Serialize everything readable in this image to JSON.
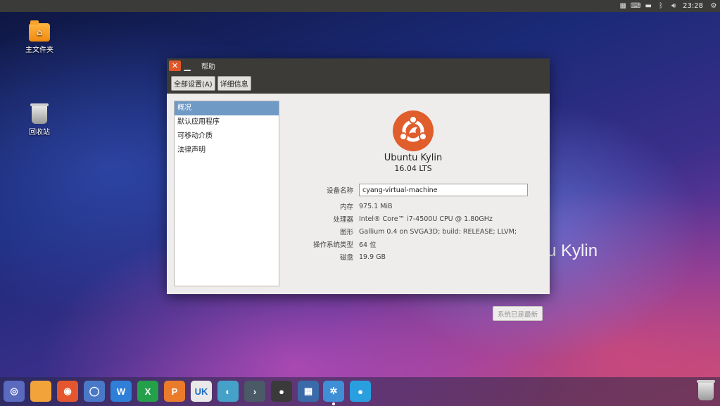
{
  "top_panel": {
    "indicators": [
      "calendar-icon",
      "keyboard-icon",
      "input-method-icon",
      "bluetooth-icon",
      "volume-icon"
    ],
    "clock": "23:28",
    "settings_icon": "gear-icon"
  },
  "desktop": {
    "icons": [
      {
        "label": "主文件夹",
        "icon": "home-folder-icon"
      },
      {
        "label": "回收站",
        "icon": "trash-icon"
      }
    ],
    "watermark": "u Kylin"
  },
  "window": {
    "title": "帮助",
    "toolbar": {
      "all_settings": "全部设置(A)",
      "details": "详细信息"
    },
    "nav": [
      "概况",
      "默认应用程序",
      "可移动介质",
      "法律声明"
    ],
    "selected_nav": 0,
    "logo": {
      "name": "Ubuntu Kylin",
      "version": "16.04  LTS"
    },
    "info": {
      "device_name_label": "设备名称",
      "device_name_value": "cyang-virtual-machine",
      "memory_label": "内存",
      "memory_value": "975.1 MiB",
      "processor_label": "处理器",
      "processor_value": "Intel® Core™ i7-4500U CPU @ 1.80GHz",
      "graphics_label": "图形",
      "graphics_value": "Gallium 0.4 on SVGA3D; build: RELEASE;  LLVM;",
      "os_type_label": "操作系统类型",
      "os_type_value": "64 位",
      "disk_label": "磁盘",
      "disk_value": "19.9 GB"
    },
    "update_button": "系统已是最新"
  },
  "dock": {
    "items": [
      {
        "name": "start-menu",
        "icon": "ubuntu-kylin-icon",
        "glyph": "◎",
        "color": "#5a6abf"
      },
      {
        "name": "files",
        "icon": "folder-icon",
        "glyph": "",
        "color": "#f2a43a"
      },
      {
        "name": "firefox",
        "icon": "firefox-icon",
        "glyph": "◉",
        "color": "#e4572e"
      },
      {
        "name": "chromium",
        "icon": "browser-icon",
        "glyph": "◯",
        "color": "#4a78c8"
      },
      {
        "name": "wps-writer",
        "icon": "writer-icon",
        "glyph": "W",
        "color": "#2f7fd8"
      },
      {
        "name": "wps-spreadsheet",
        "icon": "spreadsheet-icon",
        "glyph": "X",
        "color": "#24a04a"
      },
      {
        "name": "wps-presentation",
        "icon": "presentation-icon",
        "glyph": "P",
        "color": "#ea7b2a"
      },
      {
        "name": "software-center",
        "icon": "software-center-icon",
        "glyph": "UK",
        "color": "#e9e9e9"
      },
      {
        "name": "assistant",
        "icon": "assistant-icon",
        "glyph": "◐",
        "color": "#46a1c8"
      },
      {
        "name": "terminal",
        "icon": "terminal-icon",
        "glyph": "›",
        "color": "#4a5a66"
      },
      {
        "name": "video-player",
        "icon": "video-player-icon",
        "glyph": "●",
        "color": "#3a3a3a"
      },
      {
        "name": "workspace-switcher",
        "icon": "workspaces-icon",
        "glyph": "▦",
        "color": "#3a6aa8"
      },
      {
        "name": "system-settings",
        "icon": "settings-gear-icon",
        "glyph": "✲",
        "color": "#3f8fd6",
        "active": true
      },
      {
        "name": "system-info",
        "icon": "system-info-icon",
        "glyph": "●",
        "color": "#2a9fe0"
      }
    ],
    "trash_icon": "trash-icon"
  }
}
